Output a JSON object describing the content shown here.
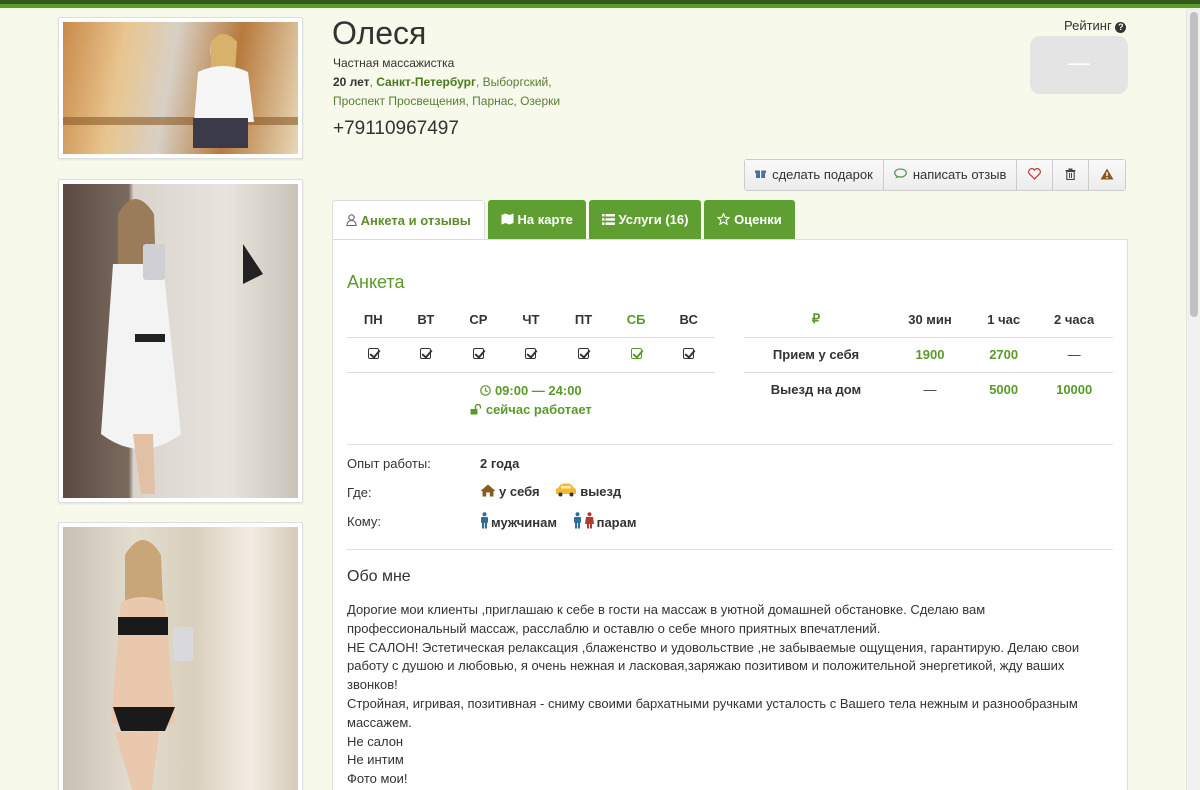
{
  "profile": {
    "name": "Олеся",
    "subtitle": "Частная массажистка",
    "age": "20 лет",
    "city": "Санкт-Петербург",
    "districts_line1": ", Выборгский,",
    "districts_line2": "Проспект Просвещения, Парнас, Озерки",
    "phone": "+79110967497"
  },
  "rating": {
    "label": "Рейтинг",
    "help_icon": "question-circle-icon",
    "value": "—"
  },
  "actions": [
    {
      "label": "сделать подарок",
      "icon": "gift-icon"
    },
    {
      "label": "написать отзыв",
      "icon": "comment-icon"
    },
    {
      "label": "",
      "icon": "heart-icon"
    },
    {
      "label": "",
      "icon": "trash-icon"
    },
    {
      "label": "",
      "icon": "warning-icon"
    }
  ],
  "tabs": [
    {
      "label": "Анкета и отзывы",
      "icon": "user-icon",
      "active": true
    },
    {
      "label": "На карте",
      "icon": "map-icon",
      "active": false
    },
    {
      "label": "Услуги (16)",
      "icon": "list-icon",
      "active": false
    },
    {
      "label": "Оценки",
      "icon": "star-icon",
      "active": false
    }
  ],
  "anketa": {
    "heading": "Анкета",
    "days": [
      "ПН",
      "ВТ",
      "СР",
      "ЧТ",
      "ПТ",
      "СБ",
      "ВС"
    ],
    "weekend_highlight": "СБ",
    "hours": "09:00 — 24:00",
    "status": "сейчас работает",
    "accent_color": "#5a9a2a"
  },
  "prices": {
    "currency": "₽",
    "columns": [
      "30 мин",
      "1 час",
      "2 часа"
    ],
    "rows": [
      {
        "label": "Прием у себя",
        "values": [
          "1900",
          "2700",
          "—"
        ]
      },
      {
        "label": "Выезд на дом",
        "values": [
          "—",
          "5000",
          "10000"
        ]
      }
    ]
  },
  "details": {
    "experience_label": "Опыт работы:",
    "experience_value": "2 года",
    "where_label": "Где:",
    "where_home": "у себя",
    "where_outcall": "выезд",
    "whom_label": "Кому:",
    "whom_men": "мужчинам",
    "whom_couples": "парам"
  },
  "about": {
    "heading": "Обо мне",
    "lines": [
      "Дорогие мои клиенты ,приглашаю к себе в гости на массаж в уютной домашней обстановке. Сделаю вам профессиональный массаж, расслаблю и оставлю о себе много приятных впечатлений.",
      "НЕ САЛОН! Эстетическая релаксация ,блаженство и удовольствие ,не забываемые ощущения, гарантирую. Делаю свои работу с душою и любовью, я очень нежная и ласковая,заряжаю позитивом и положительной энергетикой, жду ваших звонков!",
      "Стройная, игривая, позитивная - сниму своими бархатными ручками усталость с Вашего тела нежным и разнообразным массажем.",
      "Не салон",
      "Не интим",
      "Фото мои!"
    ]
  }
}
